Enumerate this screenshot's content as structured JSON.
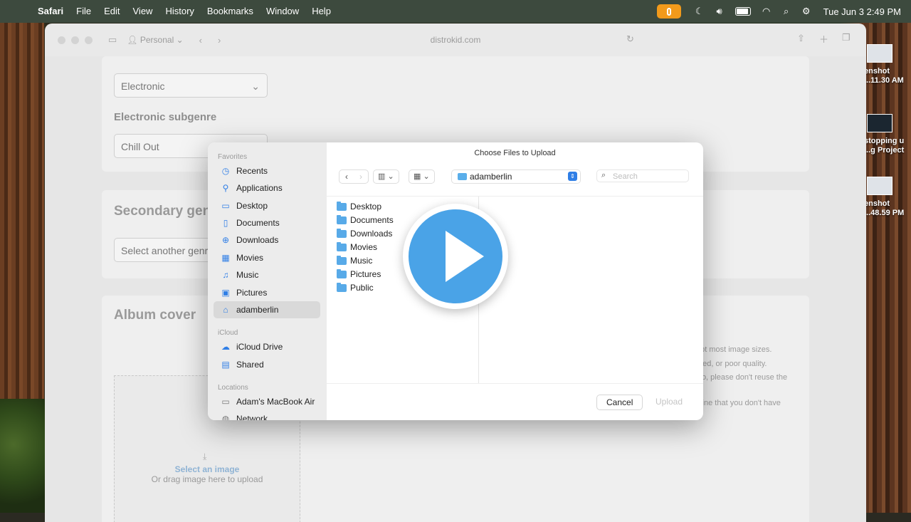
{
  "menubar": {
    "app": "Safari",
    "items": [
      "File",
      "Edit",
      "View",
      "History",
      "Bookmarks",
      "Window",
      "Help"
    ],
    "clock": "Tue Jun 3  2:49 PM",
    "accent": "#f29a1b"
  },
  "desktop": {
    "files": [
      {
        "line1": "enshot",
        "line2": "...11.30 AM"
      },
      {
        "line1": "stopping u",
        "line2": "...g Project"
      },
      {
        "line1": "enshot",
        "line2": "...48.59 PM"
      }
    ]
  },
  "browser": {
    "profile": "Personal",
    "url": "distrokid.com"
  },
  "page": {
    "genre_value": "Electronic",
    "subgenre_label": "Electronic subgenre",
    "subgenre_value": "Chill Out",
    "secondary_title": "Secondary genre",
    "secondary_placeholder": "Select another genre",
    "album_cover_title": "Album cover",
    "dropzone_link": "Select an image",
    "dropzone_hint": "Or drag image here to upload",
    "cover_text": [
      "ept most image sizes.",
      "ated, or poor quality.",
      "lso, please don't reuse the",
      "",
      "nline that you don't have"
    ]
  },
  "dialog": {
    "title": "Choose Files to Upload",
    "sidebar": {
      "favorites_heading": "Favorites",
      "favorites": [
        {
          "label": "Recents",
          "icon": "clock-icon"
        },
        {
          "label": "Applications",
          "icon": "applications-icon"
        },
        {
          "label": "Desktop",
          "icon": "desktop-icon"
        },
        {
          "label": "Documents",
          "icon": "document-icon"
        },
        {
          "label": "Downloads",
          "icon": "download-icon"
        },
        {
          "label": "Movies",
          "icon": "film-icon"
        },
        {
          "label": "Music",
          "icon": "music-note-icon"
        },
        {
          "label": "Pictures",
          "icon": "photo-icon"
        },
        {
          "label": "adamberlin",
          "icon": "home-icon"
        }
      ],
      "icloud_heading": "iCloud",
      "icloud": [
        {
          "label": "iCloud Drive",
          "icon": "cloud-icon"
        },
        {
          "label": "Shared",
          "icon": "shared-folder-icon"
        }
      ],
      "locations_heading": "Locations",
      "locations": [
        {
          "label": "Adam's MacBook Air",
          "icon": "laptop-icon"
        },
        {
          "label": "Network",
          "icon": "globe-icon"
        }
      ],
      "selected": "adamberlin"
    },
    "path": "adamberlin",
    "search_placeholder": "Search",
    "folders": [
      "Desktop",
      "Documents",
      "Downloads",
      "Movies",
      "Music",
      "Pictures",
      "Public"
    ],
    "cancel_label": "Cancel",
    "upload_label": "Upload",
    "accent": "#2f7ee6"
  }
}
